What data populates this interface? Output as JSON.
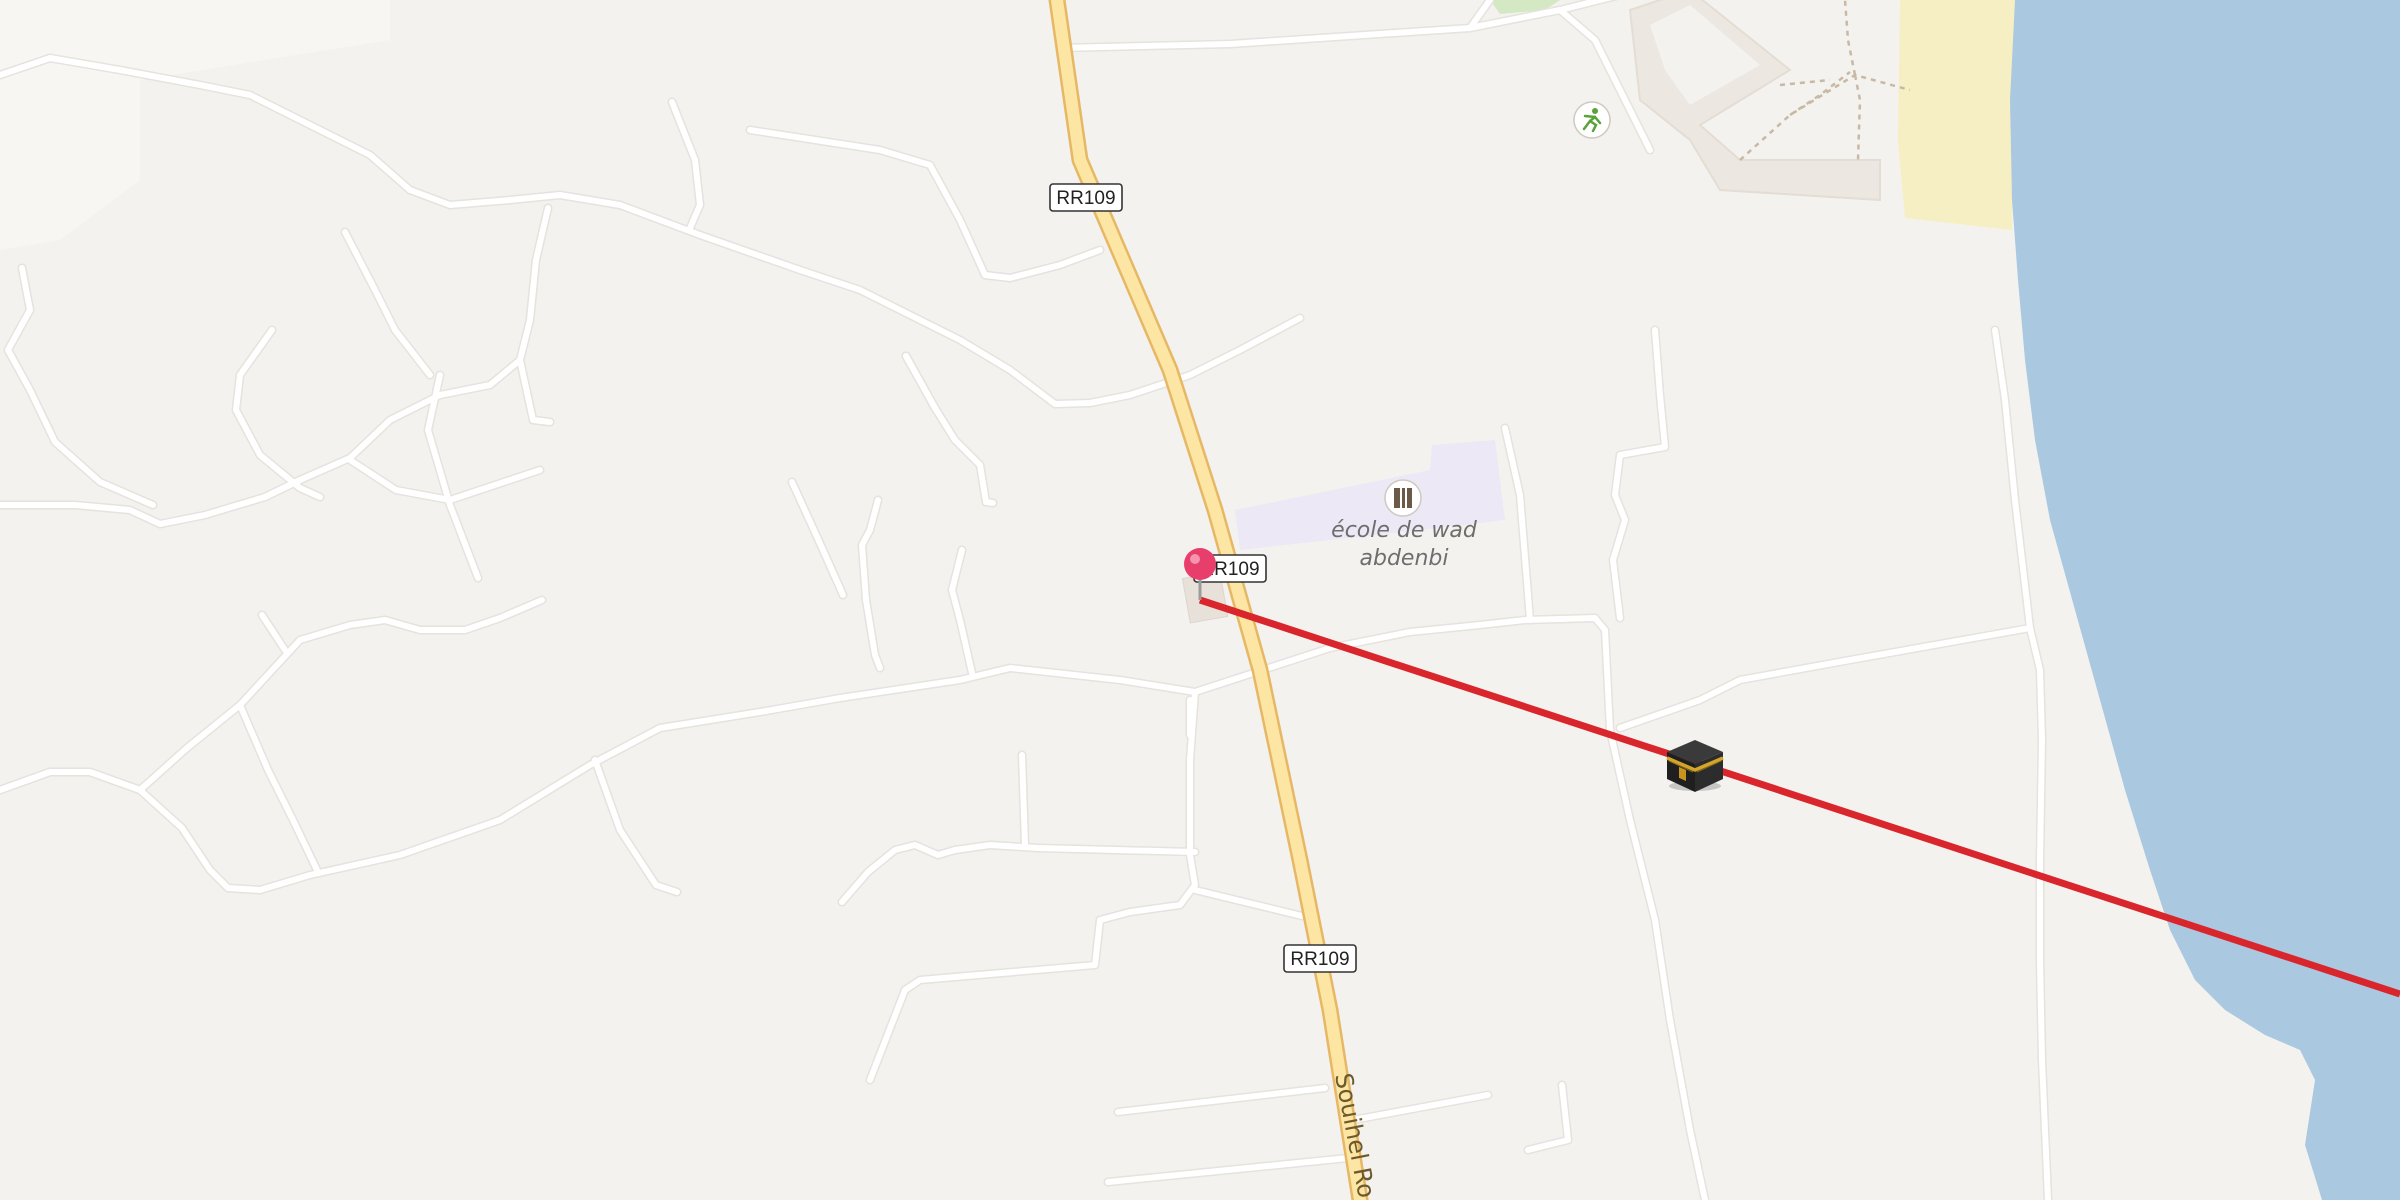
{
  "map": {
    "road_shields": [
      {
        "label": "RR109"
      },
      {
        "label": "RR109"
      },
      {
        "label": "RR109"
      }
    ],
    "road_name": "Souihel Ro",
    "poi": {
      "school_label_line1": "école de wad",
      "school_label_line2": "abdenbi"
    },
    "colors": {
      "background": "#f4f2ef",
      "water": "#aac9e0",
      "sand": "#f5efc3",
      "school_area": "#ece8f5",
      "primary_road_fill": "#fde6a4",
      "primary_road_casing": "#e6b866",
      "route_line": "#d9262c",
      "marker": "#e83e6c"
    },
    "icons": {
      "marker": "map-pin-icon",
      "destination": "kaaba-icon",
      "school": "school-icon",
      "sports": "sports-pitch-icon"
    }
  }
}
